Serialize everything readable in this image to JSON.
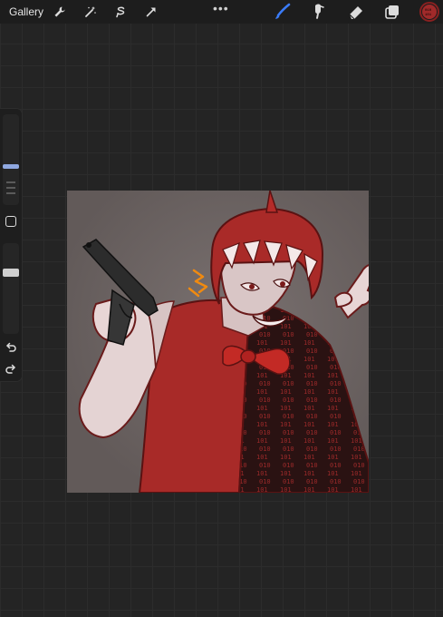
{
  "topbar": {
    "gallery_label": "Gallery",
    "more_label": "•••"
  },
  "colors": {
    "brush_active": "#3a7bf7",
    "current_color": "#a12a2a",
    "canvas_bg": "#6f6766"
  },
  "icons": [
    "wrench-icon",
    "magic-wand-icon",
    "selection-icon",
    "transform-arrow-icon",
    "brush-icon",
    "smudge-icon",
    "eraser-icon",
    "layers-icon",
    "color-picker-icon",
    "undo-icon",
    "redo-icon",
    "modify-button-icon"
  ],
  "brush_size_level": 0.3,
  "opacity_level": 0.3
}
